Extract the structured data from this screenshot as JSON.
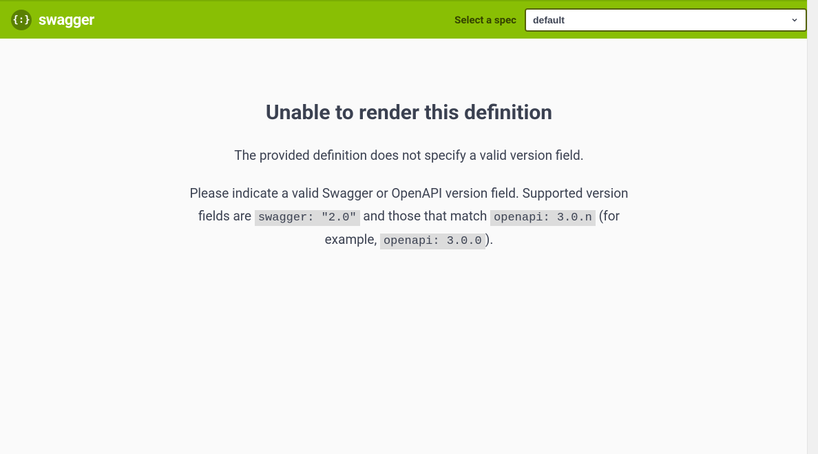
{
  "header": {
    "brand_text": "swagger",
    "logo_glyph": "{:}",
    "spec_label": "Select a spec",
    "spec_selected": "default"
  },
  "error": {
    "heading": "Unable to render this definition",
    "line1": "The provided definition does not specify a valid version field.",
    "line2_part1": "Please indicate a valid Swagger or OpenAPI version field. Supported version fields are ",
    "code1": "swagger: \"2.0\"",
    "line2_part2": " and those that match ",
    "code2": "openapi: 3.0.n",
    "line2_part3": " (for example, ",
    "code3": "openapi: 3.0.0",
    "line2_part4": ")."
  }
}
